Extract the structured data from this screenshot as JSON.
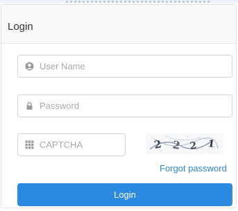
{
  "panel": {
    "title": "Login"
  },
  "username": {
    "placeholder": "User Name",
    "icon": "user-icon"
  },
  "password": {
    "placeholder": "Password",
    "icon": "lock-icon"
  },
  "captcha": {
    "placeholder": "CAPTCHA",
    "icon": "grid-icon",
    "image_text": "2 2 2 1"
  },
  "forgot_password": {
    "label": "Forgot password"
  },
  "login_button": {
    "label": "Login"
  },
  "colors": {
    "accent": "#2a8ae1",
    "link": "#2e85d0",
    "border": "#d4d4d4"
  }
}
